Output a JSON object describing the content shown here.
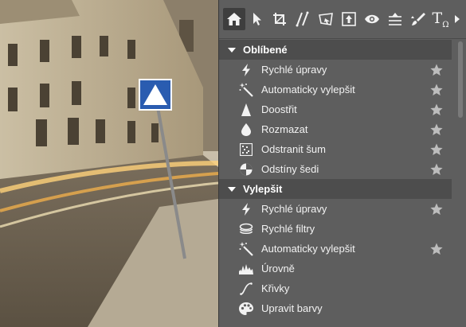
{
  "toolbar": {
    "tools": [
      {
        "icon": "home-icon",
        "active": true
      },
      {
        "icon": "pointer-icon"
      },
      {
        "icon": "crop-icon"
      },
      {
        "icon": "straighten-icon"
      },
      {
        "icon": "perspective-icon"
      },
      {
        "icon": "resize-icon"
      },
      {
        "icon": "eye-icon"
      },
      {
        "icon": "levels-tool-icon"
      },
      {
        "icon": "brush-icon"
      },
      {
        "icon": "text-icon",
        "glyph": "T",
        "sub": "Ω"
      },
      {
        "icon": "more-arrow-icon"
      }
    ]
  },
  "sections": [
    {
      "title": "Oblíbené",
      "items": [
        {
          "label": "Rychlé úpravy",
          "icon": "lightning-icon",
          "starred": true
        },
        {
          "label": "Automaticky vylepšit",
          "icon": "magic-wand-icon",
          "starred": true
        },
        {
          "label": "Doostřit",
          "icon": "sharpen-triangle-icon",
          "starred": true
        },
        {
          "label": "Rozmazat",
          "icon": "blur-drop-icon",
          "starred": true
        },
        {
          "label": "Odstranit šum",
          "icon": "noise-grid-icon",
          "starred": true
        },
        {
          "label": "Odstíny šedi",
          "icon": "grayscale-circle-icon",
          "starred": true
        }
      ]
    },
    {
      "title": "Vylepšit",
      "items": [
        {
          "label": "Rychlé úpravy",
          "icon": "lightning-icon",
          "starred": true
        },
        {
          "label": "Rychlé filtry",
          "icon": "layers-icon",
          "starred": false
        },
        {
          "label": "Automaticky vylepšit",
          "icon": "magic-wand-icon",
          "starred": true
        },
        {
          "label": "Úrovně",
          "icon": "histogram-icon",
          "starred": false
        },
        {
          "label": "Křivky",
          "icon": "curve-icon",
          "starred": false
        },
        {
          "label": "Upravit barvy",
          "icon": "palette-icon",
          "starred": false
        }
      ]
    }
  ],
  "colors": {
    "panel": "#5e5e5e",
    "header": "#4d4d4d",
    "text": "#f2f2f2",
    "star": "#bdbdbd"
  }
}
